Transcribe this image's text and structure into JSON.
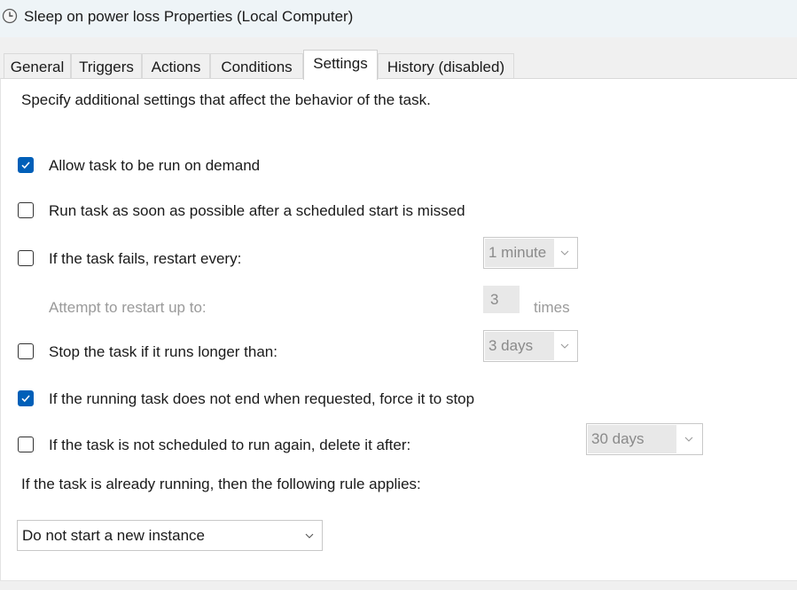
{
  "window": {
    "title": "Sleep on power loss Properties (Local Computer)",
    "icon": "clock-icon"
  },
  "tabs": [
    {
      "label": "General"
    },
    {
      "label": "Triggers"
    },
    {
      "label": "Actions"
    },
    {
      "label": "Conditions"
    },
    {
      "label": "Settings",
      "active": true
    },
    {
      "label": "History (disabled)"
    }
  ],
  "settings": {
    "description": "Specify additional settings that affect the behavior of the task.",
    "allow_on_demand": {
      "label": "Allow task to be run on demand",
      "checked": true
    },
    "run_asap": {
      "label": "Run task as soon as possible after a scheduled start is missed",
      "checked": false
    },
    "restart_on_fail": {
      "label": "If the task fails, restart every:",
      "checked": false,
      "interval": "1 minute"
    },
    "restart_attempts": {
      "label": "Attempt to restart up to:",
      "value": "3",
      "unit": "times"
    },
    "stop_if_longer": {
      "label": "Stop the task if it runs longer than:",
      "checked": false,
      "duration": "3 days"
    },
    "force_stop": {
      "label": "If the running task does not end when requested, force it to stop",
      "checked": true
    },
    "delete_if_not_scheduled": {
      "label": "If the task is not scheduled to run again, delete it after:",
      "checked": false,
      "duration": "30 days"
    },
    "running_rule_label": "If the task is already running, then the following rule applies:",
    "running_rule_value": "Do not start a new instance"
  },
  "colors": {
    "accent": "#005fb8",
    "titlebar": "#eef4f7",
    "disabled_text": "#9a9a9a"
  }
}
